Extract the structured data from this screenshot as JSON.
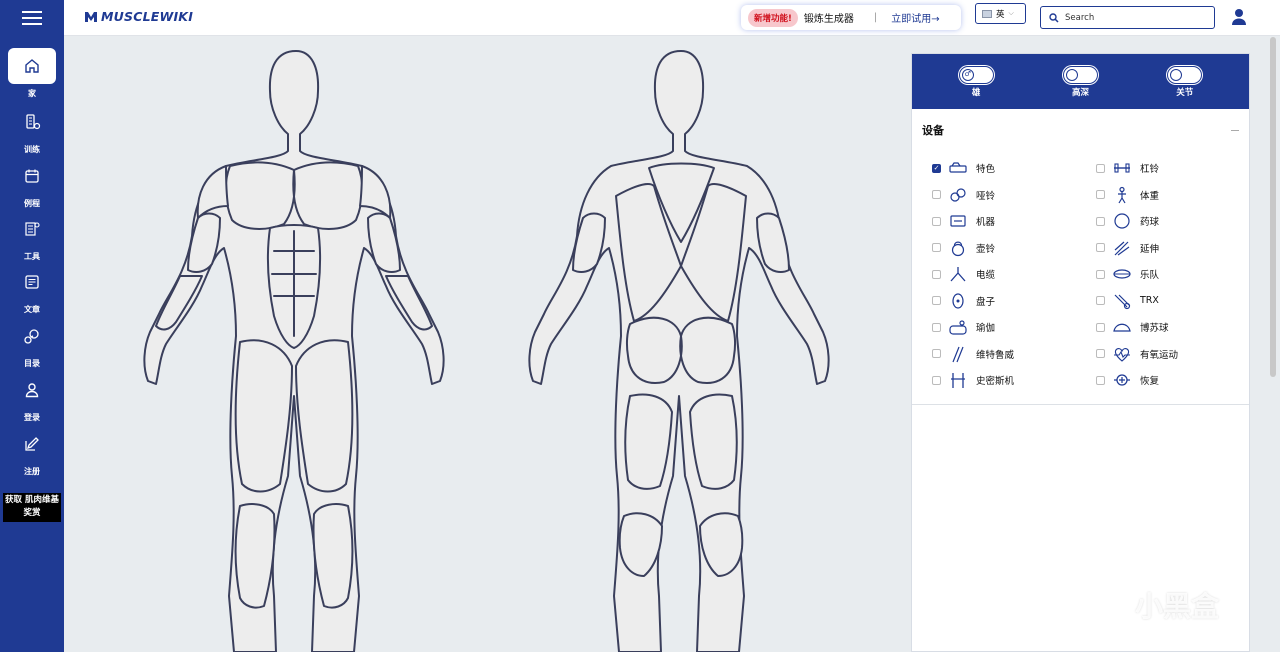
{
  "header": {
    "logo_text": "MUSCLEWIKI",
    "promo": {
      "badge": "新增功能!",
      "title": "锻炼生成器",
      "separator": "|",
      "cta": "立即试用→"
    },
    "language": "英",
    "search_placeholder": "Search"
  },
  "sidebar": {
    "items": [
      {
        "label": "家",
        "icon": "home-icon"
      },
      {
        "label": "训练",
        "icon": "workout-icon"
      },
      {
        "label": "例程",
        "icon": "calendar-icon"
      },
      {
        "label": "工具",
        "icon": "tools-icon"
      },
      {
        "label": "文章",
        "icon": "article-icon"
      },
      {
        "label": "目录",
        "icon": "directory-icon"
      },
      {
        "label": "登录",
        "icon": "user-icon"
      },
      {
        "label": "注册",
        "icon": "edit-icon"
      }
    ],
    "promo_box": "获取 肌肉维基奖赏"
  },
  "filters": {
    "toggles": [
      {
        "label": "雄",
        "icon": "male-icon"
      },
      {
        "label": "高深",
        "icon": "level-icon"
      },
      {
        "label": "关节",
        "icon": "joint-icon"
      }
    ]
  },
  "equipment": {
    "title": "设备",
    "items": [
      {
        "label": "特色",
        "icon": "featured-icon",
        "checked": true
      },
      {
        "label": "杠铃",
        "icon": "barbell-icon",
        "checked": false
      },
      {
        "label": "哑铃",
        "icon": "dumbbell-icon",
        "checked": false
      },
      {
        "label": "体重",
        "icon": "bodyweight-icon",
        "checked": false
      },
      {
        "label": "机器",
        "icon": "machine-icon",
        "checked": false
      },
      {
        "label": "药球",
        "icon": "medicine-ball-icon",
        "checked": false
      },
      {
        "label": "壶铃",
        "icon": "kettlebell-icon",
        "checked": false
      },
      {
        "label": "延伸",
        "icon": "stretch-icon",
        "checked": false
      },
      {
        "label": "电缆",
        "icon": "cable-icon",
        "checked": false
      },
      {
        "label": "乐队",
        "icon": "band-icon",
        "checked": false
      },
      {
        "label": "盘子",
        "icon": "plate-icon",
        "checked": false
      },
      {
        "label": "TRX",
        "icon": "trx-icon",
        "checked": false
      },
      {
        "label": "瑜伽",
        "icon": "yoga-icon",
        "checked": false
      },
      {
        "label": "博苏球",
        "icon": "bosu-ball-icon",
        "checked": false
      },
      {
        "label": "维特鲁威",
        "icon": "vitruvian-icon",
        "checked": false
      },
      {
        "label": "有氧运动",
        "icon": "cardio-icon",
        "checked": false
      },
      {
        "label": "史密斯机",
        "icon": "smith-machine-icon",
        "checked": false
      },
      {
        "label": "恢复",
        "icon": "recovery-icon",
        "checked": false
      }
    ]
  },
  "watermark": "小黑盒",
  "colors": {
    "brand": "#1f3a93",
    "body_fill": "#ededed",
    "body_stroke": "#3a3f5c",
    "badge_bg": "#f7c7cc",
    "badge_text": "#d0101c"
  }
}
